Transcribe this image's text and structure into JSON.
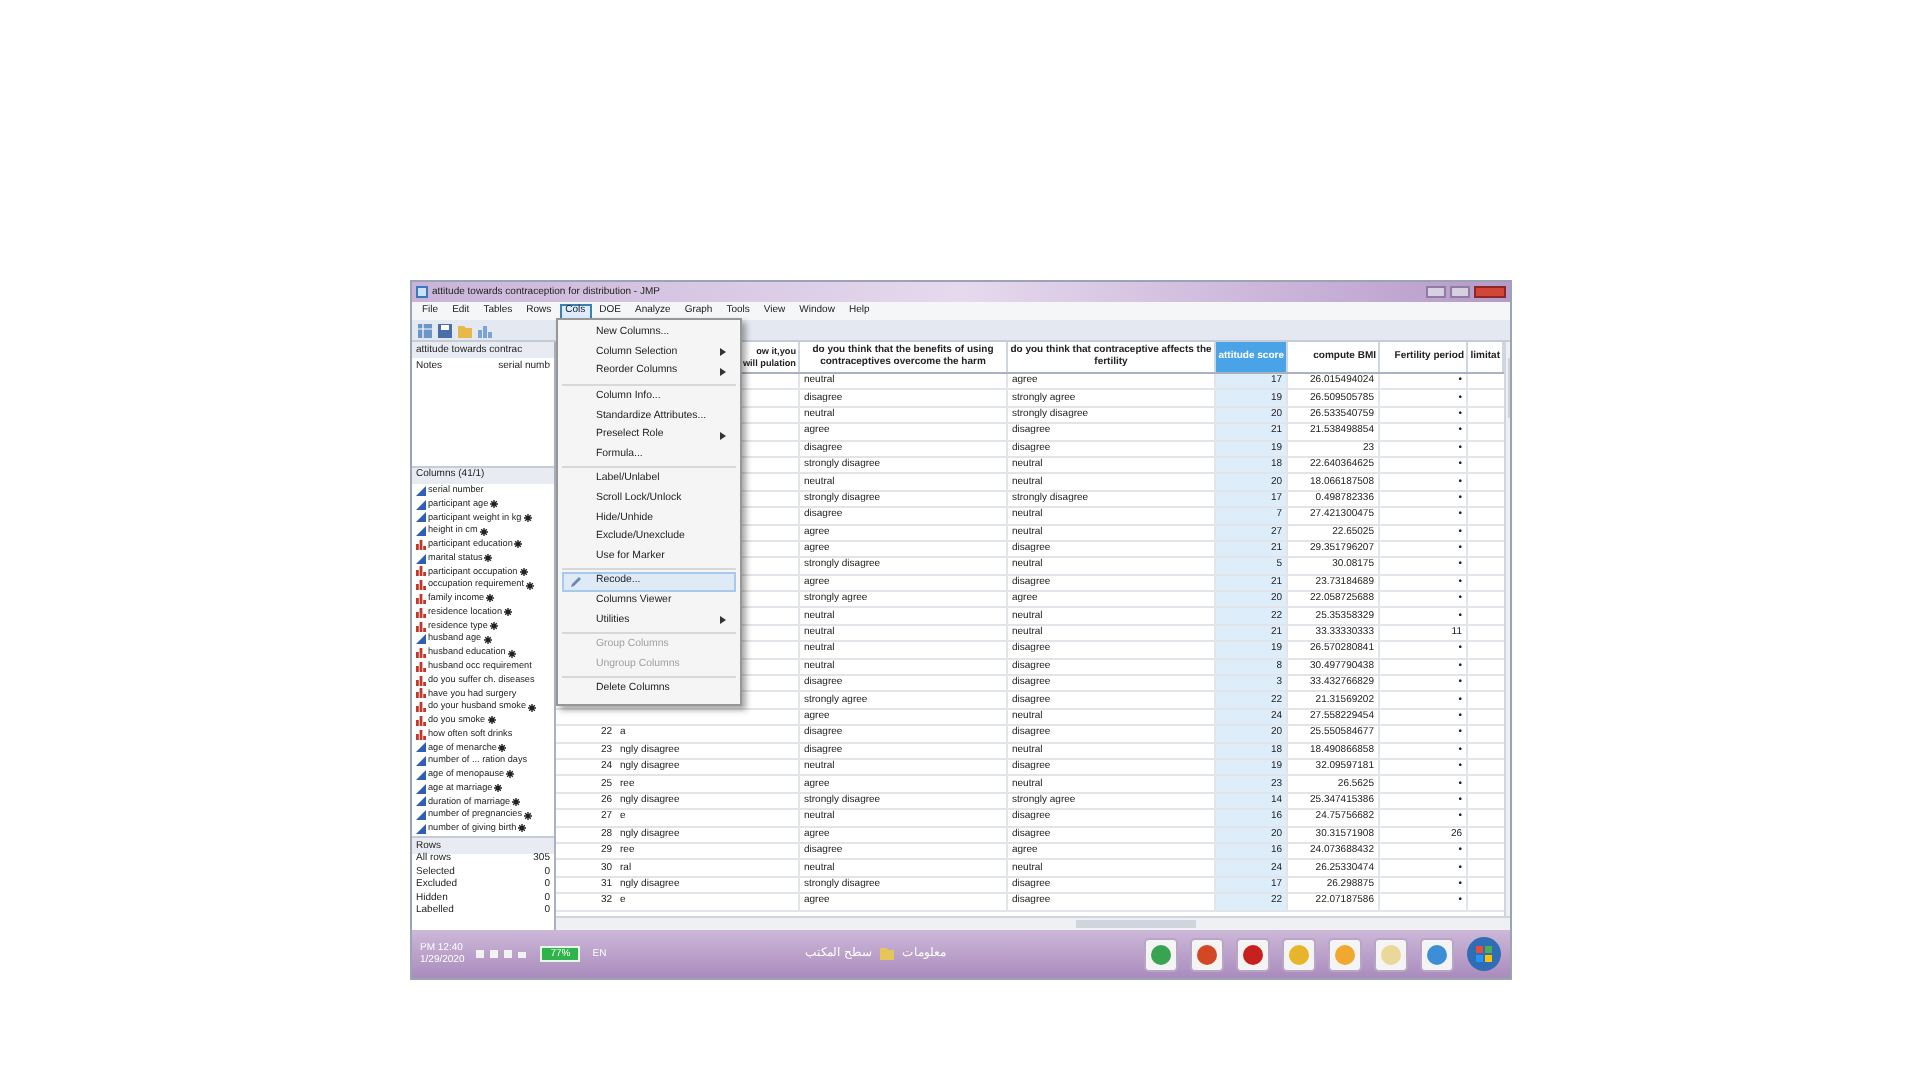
{
  "window": {
    "title": "attitude towards contraception for distribution - JMP"
  },
  "menu_bar": [
    {
      "label": "File",
      "selected": false
    },
    {
      "label": "Edit",
      "selected": false
    },
    {
      "label": "Tables",
      "selected": false
    },
    {
      "label": "Rows",
      "selected": false
    },
    {
      "label": "Cols",
      "selected": true
    },
    {
      "label": "DOE",
      "selected": false
    },
    {
      "label": "Analyze",
      "selected": false
    },
    {
      "label": "Graph",
      "selected": false
    },
    {
      "label": "Tools",
      "selected": false
    },
    {
      "label": "View",
      "selected": false
    },
    {
      "label": "Window",
      "selected": false
    },
    {
      "label": "Help",
      "selected": false
    }
  ],
  "cols_menu": [
    [
      {
        "label": "New Columns...",
        "submenu": false,
        "highlighted": false,
        "disabled": false
      },
      {
        "label": "Column Selection",
        "submenu": true,
        "highlighted": false,
        "disabled": false
      },
      {
        "label": "Reorder Columns",
        "submenu": true,
        "highlighted": false,
        "disabled": false
      }
    ],
    [
      {
        "label": "Column Info...",
        "submenu": false,
        "highlighted": false,
        "disabled": false
      },
      {
        "label": "Standardize Attributes...",
        "submenu": false,
        "highlighted": false,
        "disabled": false
      },
      {
        "label": "Preselect Role",
        "submenu": true,
        "highlighted": false,
        "disabled": false
      },
      {
        "label": "Formula...",
        "submenu": false,
        "highlighted": false,
        "disabled": false
      }
    ],
    [
      {
        "label": "Label/Unlabel",
        "submenu": false,
        "highlighted": false,
        "disabled": false
      },
      {
        "label": "Scroll Lock/Unlock",
        "submenu": false,
        "highlighted": false,
        "disabled": false
      },
      {
        "label": "Hide/Unhide",
        "submenu": false,
        "highlighted": false,
        "disabled": false
      },
      {
        "label": "Exclude/Unexclude",
        "submenu": false,
        "highlighted": false,
        "disabled": false
      },
      {
        "label": "Use for Marker",
        "submenu": false,
        "highlighted": false,
        "disabled": false
      }
    ],
    [
      {
        "label": "Recode...",
        "submenu": false,
        "highlighted": true,
        "disabled": false
      },
      {
        "label": "Columns Viewer",
        "submenu": false,
        "highlighted": false,
        "disabled": false
      },
      {
        "label": "Utilities",
        "submenu": true,
        "highlighted": false,
        "disabled": false
      }
    ],
    [
      {
        "label": "Group Columns",
        "submenu": false,
        "highlighted": false,
        "disabled": true
      },
      {
        "label": "Ungroup Columns",
        "submenu": false,
        "highlighted": false,
        "disabled": true
      }
    ],
    [
      {
        "label": "Delete Columns",
        "submenu": false,
        "highlighted": false,
        "disabled": false
      }
    ]
  ],
  "left_panel": {
    "table_name": "attitude towards contrac",
    "notes_label": "Notes",
    "notes_value": "serial numb",
    "columns_header": "Columns (41/1)",
    "columns": [
      {
        "name": "serial number",
        "kind": "continuous",
        "marked": false
      },
      {
        "name": "participant age",
        "kind": "continuous",
        "marked": true
      },
      {
        "name": "participant weight in kg",
        "kind": "continuous",
        "marked": true
      },
      {
        "name": "height in cm",
        "kind": "continuous",
        "marked": true
      },
      {
        "name": "participant education",
        "kind": "nominal",
        "marked": true
      },
      {
        "name": "marital status",
        "kind": "continuous",
        "marked": true
      },
      {
        "name": "participant occupation",
        "kind": "nominal",
        "marked": true
      },
      {
        "name": "occupation requirement",
        "kind": "nominal",
        "marked": true
      },
      {
        "name": "family income",
        "kind": "nominal",
        "marked": true
      },
      {
        "name": "residence location",
        "kind": "nominal",
        "marked": true
      },
      {
        "name": "residence type",
        "kind": "nominal",
        "marked": true
      },
      {
        "name": "husband age",
        "kind": "continuous",
        "marked": true
      },
      {
        "name": "husband education",
        "kind": "nominal",
        "marked": true
      },
      {
        "name": "husband occ requirement",
        "kind": "nominal",
        "marked": false
      },
      {
        "name": "do you suffer ch. diseases",
        "kind": "nominal",
        "marked": false
      },
      {
        "name": "have you had surgery",
        "kind": "nominal",
        "marked": false
      },
      {
        "name": "do your husband smoke",
        "kind": "nominal",
        "marked": true
      },
      {
        "name": "do you smoke",
        "kind": "nominal",
        "marked": true
      },
      {
        "name": "how often soft drinks",
        "kind": "nominal",
        "marked": false
      },
      {
        "name": "age of menarche",
        "kind": "continuous",
        "marked": true
      },
      {
        "name": "number of ... ration days",
        "kind": "continuous",
        "marked": false
      },
      {
        "name": "age of menopause",
        "kind": "continuous",
        "marked": true
      },
      {
        "name": "age at marriage",
        "kind": "continuous",
        "marked": true
      },
      {
        "name": "duration of marriage",
        "kind": "continuous",
        "marked": true
      },
      {
        "name": "number of pregnancies",
        "kind": "continuous",
        "marked": true
      },
      {
        "name": "number of giving birth",
        "kind": "continuous",
        "marked": true
      }
    ],
    "rows_header": "Rows",
    "row_counts": [
      {
        "label": "All rows",
        "value": "305"
      },
      {
        "label": "Selected",
        "value": "0"
      },
      {
        "label": "Excluded",
        "value": "0"
      },
      {
        "label": "Hidden",
        "value": "0"
      },
      {
        "label": "Labelled",
        "value": "0"
      }
    ]
  },
  "table": {
    "columns": [
      {
        "label": "ow it,you will pulation",
        "selected": false
      },
      {
        "label": "do you think that the benefits of using contraceptives overcome the harm",
        "selected": false
      },
      {
        "label": "do you think that contraceptive affects the fertility",
        "selected": false
      },
      {
        "label": "attitude score",
        "selected": true
      },
      {
        "label": "compute BMI",
        "selected": false
      },
      {
        "label": "Fertility period",
        "selected": false
      },
      {
        "label": "limitat",
        "selected": false
      }
    ],
    "rows": [
      {
        "cells": [
          "",
          "neutral",
          "agree",
          "17",
          "26.015494024",
          "•"
        ]
      },
      {
        "cells": [
          "",
          "disagree",
          "strongly agree",
          "19",
          "26.509505785",
          "•"
        ]
      },
      {
        "cells": [
          "",
          "neutral",
          "strongly disagree",
          "20",
          "26.533540759",
          "•"
        ]
      },
      {
        "cells": [
          "",
          "agree",
          "disagree",
          "21",
          "21.538498854",
          "•"
        ]
      },
      {
        "cells": [
          "",
          "disagree",
          "disagree",
          "19",
          "23",
          "•"
        ]
      },
      {
        "cells": [
          "",
          "strongly disagree",
          "neutral",
          "18",
          "22.640364625",
          "•"
        ]
      },
      {
        "cells": [
          "",
          "neutral",
          "neutral",
          "20",
          "18.066187508",
          "•"
        ]
      },
      {
        "cells": [
          "",
          "strongly disagree",
          "strongly disagree",
          "17",
          "0.498782336",
          "•"
        ]
      },
      {
        "cells": [
          "",
          "disagree",
          "neutral",
          "7",
          "27.421300475",
          "•"
        ]
      },
      {
        "cells": [
          "",
          "agree",
          "neutral",
          "27",
          "22.65025",
          "•"
        ]
      },
      {
        "cells": [
          "",
          "agree",
          "disagree",
          "21",
          "29.351796207",
          "•"
        ]
      },
      {
        "cells": [
          "",
          "strongly disagree",
          "neutral",
          "5",
          "30.08175",
          "•"
        ]
      },
      {
        "cells": [
          "",
          "agree",
          "disagree",
          "21",
          "23.73184689",
          "•"
        ]
      },
      {
        "cells": [
          "",
          "strongly agree",
          "agree",
          "20",
          "22.058725688",
          "•"
        ]
      },
      {
        "cells": [
          "",
          "neutral",
          "neutral",
          "22",
          "25.35358329",
          "•"
        ]
      },
      {
        "cells": [
          "",
          "neutral",
          "neutral",
          "21",
          "33.33330333",
          "11"
        ]
      },
      {
        "cells": [
          "",
          "neutral",
          "disagree",
          "19",
          "26.570280841",
          "•"
        ]
      },
      {
        "cells": [
          "",
          "neutral",
          "disagree",
          "8",
          "30.497790438",
          "•"
        ]
      },
      {
        "cells": [
          "",
          "disagree",
          "disagree",
          "3",
          "33.432766829",
          "•"
        ]
      },
      {
        "cells": [
          "",
          "strongly agree",
          "disagree",
          "22",
          "21.31569202",
          "•"
        ]
      },
      {
        "cells": [
          "",
          "agree",
          "neutral",
          "24",
          "27.558229454",
          "•"
        ]
      },
      {
        "row_number": "22",
        "cells": [
          "a",
          "disagree",
          "disagree",
          "20",
          "25.550584677",
          "•"
        ]
      },
      {
        "row_number": "23",
        "cells": [
          "ngly disagree",
          "disagree",
          "neutral",
          "18",
          "18.490866858",
          "•"
        ]
      },
      {
        "row_number": "24",
        "cells": [
          "ngly disagree",
          "neutral",
          "disagree",
          "19",
          "32.09597181",
          "•"
        ]
      },
      {
        "row_number": "25",
        "cells": [
          "ree",
          "agree",
          "neutral",
          "23",
          "26.5625",
          "•"
        ]
      },
      {
        "row_number": "26",
        "cells": [
          "ngly disagree",
          "strongly disagree",
          "strongly agree",
          "14",
          "25.347415386",
          "•"
        ]
      },
      {
        "row_number": "27",
        "cells": [
          "e",
          "neutral",
          "disagree",
          "16",
          "24.75756682",
          "•"
        ]
      },
      {
        "row_number": "28",
        "cells": [
          "ngly disagree",
          "agree",
          "disagree",
          "20",
          "30.31571908",
          "26"
        ]
      },
      {
        "row_number": "29",
        "cells": [
          "ree",
          "disagree",
          "agree",
          "16",
          "24.073688432",
          "•"
        ]
      },
      {
        "row_number": "30",
        "cells": [
          "ral",
          "neutral",
          "neutral",
          "24",
          "26.25330474",
          "•"
        ]
      },
      {
        "row_number": "31",
        "cells": [
          "ngly disagree",
          "strongly disagree",
          "disagree",
          "17",
          "26.298875",
          "•"
        ]
      },
      {
        "row_number": "32",
        "cells": [
          "e",
          "agree",
          "disagree",
          "22",
          "22.07187586",
          "•"
        ]
      }
    ]
  },
  "taskbar": {
    "time": "PM 12:40",
    "date": "1/29/2020",
    "battery": "77%",
    "language": "EN",
    "desktop_label": "سطح المكتب",
    "folder_label": "معلومات"
  }
}
